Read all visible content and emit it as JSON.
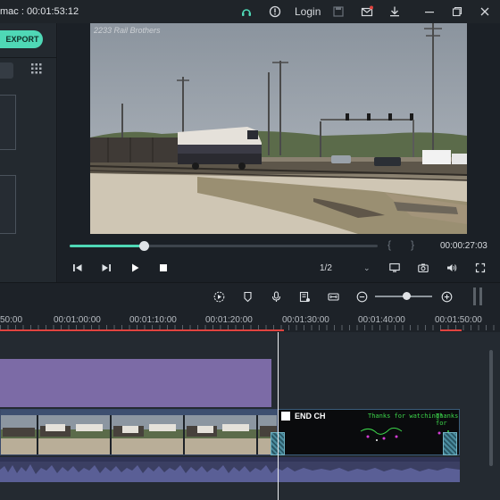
{
  "titlebar": {
    "title": "mac : 00:01:53:12",
    "login_label": "Login"
  },
  "left_panel": {
    "export_label": "EXPORT"
  },
  "video": {
    "watermark": "2233 Rail Brothers"
  },
  "player": {
    "progress": 0.24,
    "timecode": "00:00:27:03",
    "quality": "1/2",
    "brace_left": "{",
    "brace_right": "}"
  },
  "toolbar": {
    "zoom_level": 0.55
  },
  "ruler": {
    "labels": [
      "00:01:00:00",
      "00:01:10:00",
      "00:01:20:00",
      "00:01:30:00",
      "00:01:40:00",
      "00:01:50:00"
    ],
    "partial_label": "50:00"
  },
  "timeline": {
    "end_clip_title": "END CH",
    "end_clip_small_1": "Thanks for watching!",
    "end_clip_small_2": "Thanks for"
  },
  "colors": {
    "accent": "#4fd8b6",
    "purple_clip": "#7c6ba6",
    "audio_track": "#3b3f63",
    "ruler_marker": "#e0433f"
  }
}
